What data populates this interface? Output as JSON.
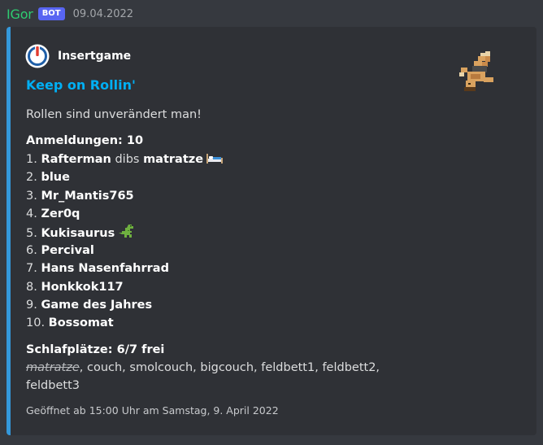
{
  "message": {
    "username": "IGor",
    "bot_tag": "BOT",
    "timestamp": "09.04.2022"
  },
  "embed": {
    "accent_color": "#3498db",
    "author": {
      "name": "Insertgame",
      "icon": "insertgame-logo-icon"
    },
    "thumbnail": "pixel-wrestler-sprite",
    "title": "Keep on Rollin'",
    "description": "Rollen sind unverändert man!",
    "registrations": {
      "heading": "Anmeldungen: 10",
      "entries": [
        {
          "num": "1.",
          "name": "Rafterman",
          "extra_plain": " dibs ",
          "extra_bold": "matratze",
          "emoji": "bed-icon"
        },
        {
          "num": "2.",
          "name": "blue"
        },
        {
          "num": "3.",
          "name": "Mr_Mantis765"
        },
        {
          "num": "4.",
          "name": "Zer0q"
        },
        {
          "num": "5.",
          "name": "Kukisaurus",
          "emoji": "dinosaur-icon"
        },
        {
          "num": "6.",
          "name": "Percival"
        },
        {
          "num": "7.",
          "name": "Hans Nasenfahrrad"
        },
        {
          "num": "8.",
          "name": "Honkkok117"
        },
        {
          "num": "9.",
          "name": "Game des Jahres"
        },
        {
          "num": "10.",
          "name": "Bossomat"
        }
      ]
    },
    "sleeping": {
      "heading": "Schlafplätze: 6/7 frei",
      "taken": "matratze",
      "rest": ", couch, smolcouch, bigcouch, feldbett1, feldbett2, feldbett3"
    },
    "footer": "Geöffnet ab 15:00 Uhr am Samstag, 9. April 2022"
  }
}
